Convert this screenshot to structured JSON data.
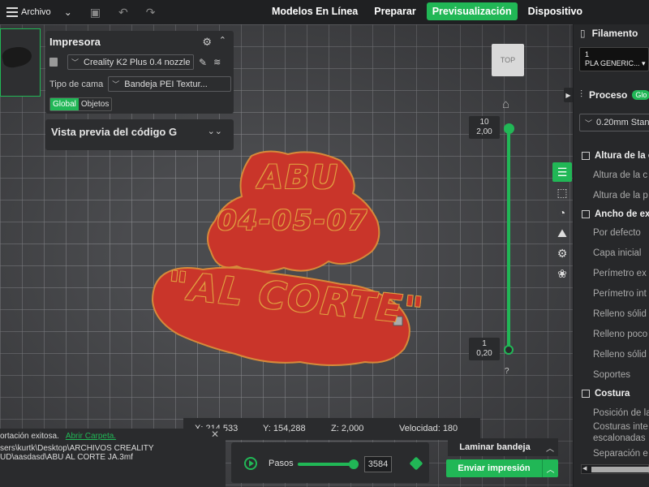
{
  "topbar": {
    "file_label": "Archivo",
    "tabs": [
      {
        "label": "Modelos En Línea"
      },
      {
        "label": "Preparar"
      },
      {
        "label": "Previsualización"
      },
      {
        "label": "Dispositivo"
      }
    ]
  },
  "printer": {
    "title": "Impresora",
    "printer_name": "Creality K2 Plus 0.4 nozzle",
    "bed_label": "Tipo de cama",
    "bed_value": "Bandeja PEI Textur...",
    "scope_global": "Global",
    "scope_objects": "Objetos"
  },
  "gcode": {
    "title": "Vista previa del código G"
  },
  "model": {
    "line1": "ABU",
    "line2": "04-05-07",
    "line3": "\"AL CORTE\""
  },
  "viewcube": {
    "face": "TOP"
  },
  "layers": {
    "top_layer": "10",
    "top_height": "2,00",
    "bottom_layer": "1",
    "bottom_height": "0,20",
    "help": "?"
  },
  "right_panel": {
    "filament_title": "Filamento",
    "filament_slot_index": "1",
    "filament_slot_name": "PLA GENERIC...",
    "process_title": "Proceso",
    "process_toggle": "Glo",
    "process_profile": "0.20mm Stan",
    "sections": [
      {
        "title": "Altura de la c"
      },
      {
        "title": "Ancho de ex"
      },
      {
        "title": "Costura"
      }
    ],
    "params": [
      "Altura de la c",
      "Altura de la p",
      "Por defecto",
      "Capa inicial",
      "Perímetro ex",
      "Perímetro int",
      "Relleno sólid",
      "Relleno poco",
      "Relleno sólid",
      "Soportes",
      "Posición de la",
      "Costuras inte",
      "escalonadas",
      "Separación e"
    ]
  },
  "coords": {
    "x": "X: 214,533",
    "y": "Y: 154,288",
    "z": "Z: 2,000",
    "speed": "Velocidad: 180"
  },
  "notice": {
    "line1": "ortación exitosa.",
    "link": "Abrir Carpeta.",
    "line2": "sers\\kurtk\\Desktop\\ARCHIVOS CREALITY",
    "line3": "UD\\aasdasd\\ABU AL CORTE JA.3mf"
  },
  "steps": {
    "label": "Pasos",
    "value": "3584"
  },
  "actions": {
    "slice_label": "Laminar bandeja",
    "print_label": "Enviar impresión"
  },
  "colors": {
    "accent": "#21b756",
    "model_red": "#c9352a",
    "model_outline": "#e0a040"
  }
}
